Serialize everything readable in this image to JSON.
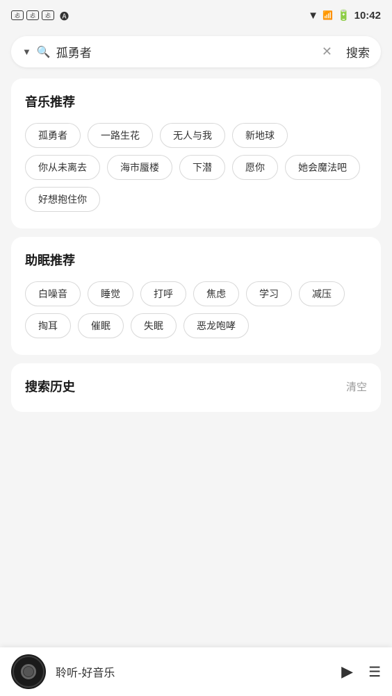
{
  "status_bar": {
    "time": "10:42",
    "icons": [
      "忐",
      "忐",
      "忐"
    ]
  },
  "search_bar": {
    "placeholder": "搜索",
    "current_value": "孤勇者",
    "search_button_label": "搜索"
  },
  "music_section": {
    "title": "音乐推荐",
    "tags": [
      "孤勇者",
      "一路生花",
      "无人与我",
      "新地球",
      "你从未离去",
      "海市蜃楼",
      "下潜",
      "愿你",
      "她会魔法吧",
      "好想抱住你"
    ]
  },
  "sleep_section": {
    "title": "助眠推荐",
    "tags": [
      "白噪音",
      "睡觉",
      "打呼",
      "焦虑",
      "学习",
      "减压",
      "掏耳",
      "催眠",
      "失眠",
      "恶龙咆哮"
    ]
  },
  "history_section": {
    "title": "搜索历史",
    "clear_label": "清空"
  },
  "player": {
    "title": "聆听-好音乐"
  }
}
